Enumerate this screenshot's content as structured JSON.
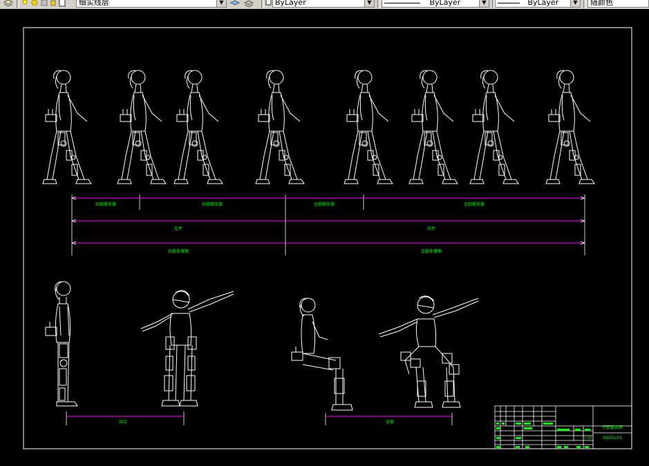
{
  "toolbar": {
    "layer_name": "细实线层",
    "color_value": "ByLayer",
    "linetype_value": "ByLayer",
    "lineweight_value": "ByLayer",
    "plotstyle_value": "随颜色"
  },
  "drawing": {
    "dim_row1": [
      "右脚摆支撑",
      "右脚摆支撑",
      "左脚摆支撑",
      "左脚摆支撑"
    ],
    "dim_row2": [
      "左步",
      "右步"
    ],
    "dim_row3": [
      "右腿支撑期",
      "左腿支撑期"
    ],
    "bottom_dims": [
      "站立",
      "坐姿"
    ],
    "title_block": {
      "drawing_title": "行走姿态图",
      "drawing_code": "XWZG-01",
      "scale": "1:10"
    }
  },
  "colors": {
    "canvas_bg": "#000000",
    "linework": "#ffffff",
    "dimension_line": "#ff00ff",
    "dimension_text": "#00ff00",
    "toolbar_bg": "#d4d0c8"
  }
}
